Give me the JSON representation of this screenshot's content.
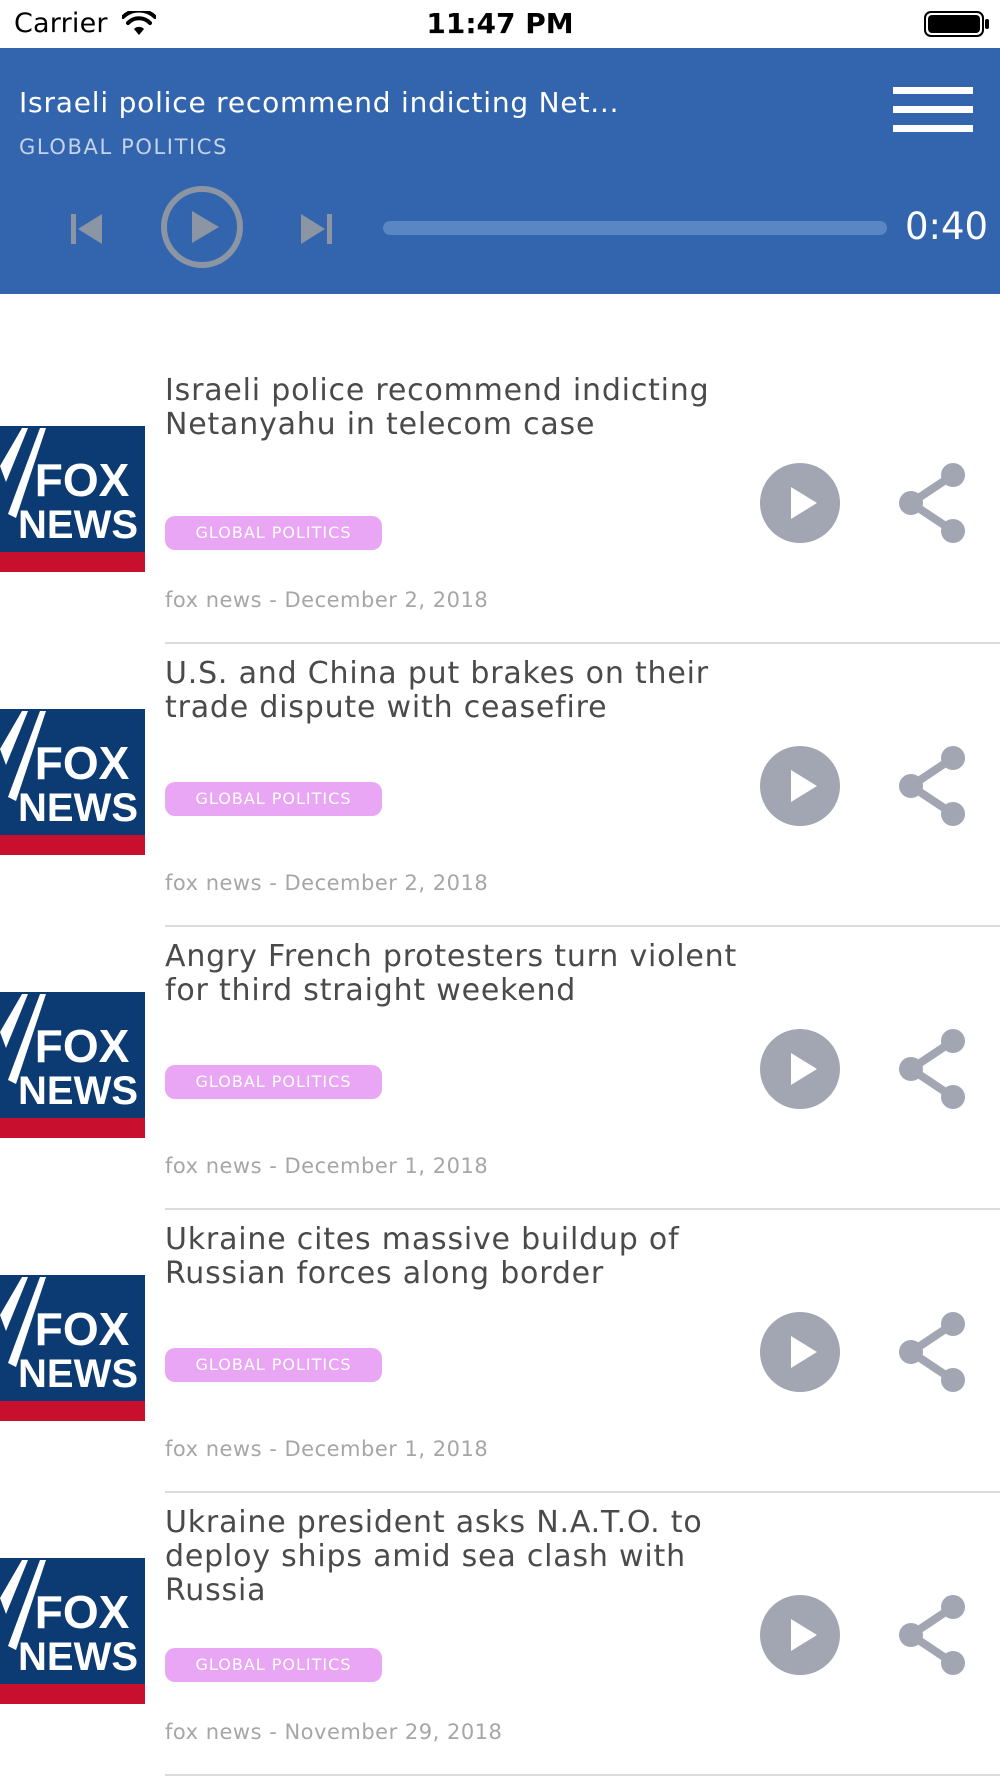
{
  "status_bar": {
    "carrier": "Carrier",
    "time": "11:47 PM"
  },
  "player": {
    "title": "Israeli police recommend indicting Net...",
    "category": "GLOBAL POLITICS",
    "elapsed": "0:40",
    "progress_fraction": 0.0
  },
  "colors": {
    "header_bg": "#3265ae",
    "badge_bg": "#e9a6f4",
    "icon_gray": "#a2a5b2",
    "fox_navy": "#0b3b72",
    "fox_red": "#c8102e"
  },
  "news": [
    {
      "logo_text_top": "FOX",
      "logo_text_bottom": "NEWS",
      "title": "Israeli police recommend indicting Netanyahu in telecom case",
      "category": "GLOBAL POLITICS",
      "meta": "fox news - December 2, 2018"
    },
    {
      "logo_text_top": "FOX",
      "logo_text_bottom": "NEWS",
      "title": "U.S. and China put brakes on their trade dispute with ceasefire",
      "category": "GLOBAL POLITICS",
      "meta": "fox news - December 2, 2018"
    },
    {
      "logo_text_top": "FOX",
      "logo_text_bottom": "NEWS",
      "title": "Angry French protesters turn violent for third straight weekend",
      "category": "GLOBAL POLITICS",
      "meta": "fox news - December 1, 2018"
    },
    {
      "logo_text_top": "FOX",
      "logo_text_bottom": "NEWS",
      "title": "Ukraine cites massive buildup of Russian forces along border",
      "category": "GLOBAL POLITICS",
      "meta": "fox news - December 1, 2018"
    },
    {
      "logo_text_top": "FOX",
      "logo_text_bottom": "NEWS",
      "title": "Ukraine president asks N.A.T.O. to deploy ships amid sea clash with Russia",
      "category": "GLOBAL POLITICS",
      "meta": "fox news - November 29, 2018"
    }
  ]
}
